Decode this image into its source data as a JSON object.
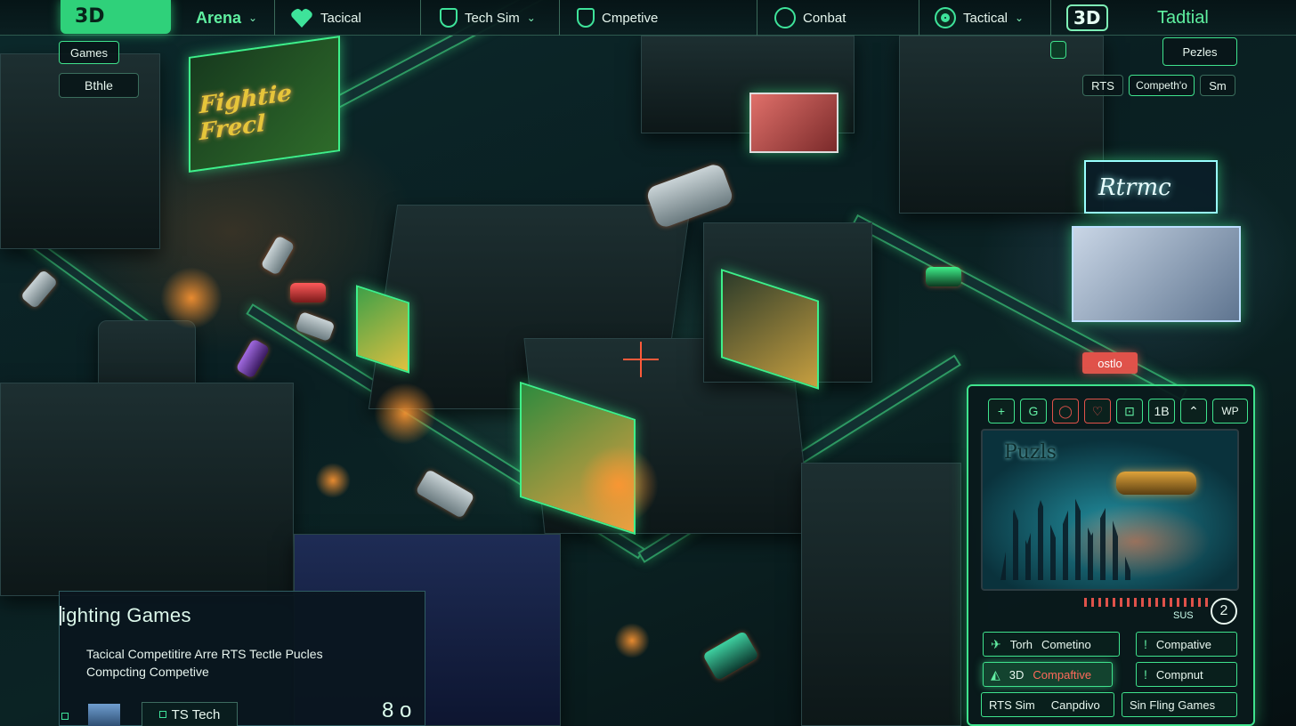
{
  "topbar": {
    "logo": "3D",
    "arena": "Arena",
    "items": [
      "Tacical",
      "Tech Sim",
      "Cmpetive",
      "Conbat",
      "Tactical"
    ],
    "badge": "3D",
    "right_label": "Tadtial"
  },
  "top_left": {
    "games": "Games",
    "battle": "Bthle"
  },
  "top_right": {
    "puzzles": "Pezles",
    "tabs": [
      "RTS",
      "Competh'o",
      "Sm"
    ]
  },
  "billboards": {
    "left_sign": "Fightie Frecl",
    "right_sign": "Rtrmc"
  },
  "floating_tag": "ostlo",
  "info_card": {
    "title": "ighting Games",
    "desc_line1": "Tacical Competitire Arre RTS Tectle Pucles",
    "desc_line2": "Compcting Competive",
    "tag": "TS Tech",
    "glyph": "8 o"
  },
  "right_panel": {
    "tools": [
      "+",
      "G",
      "◯",
      "♡",
      "⊡",
      "1B",
      "⌃",
      "WP"
    ],
    "preview_title": "Puzls",
    "meta": "SUS",
    "count": "2",
    "buttons": [
      {
        "icon": "✈",
        "a": "Torh",
        "b": "Cometino"
      },
      {
        "icon": "!",
        "a": "Compative",
        "b": ""
      },
      {
        "icon": "◭",
        "a": "3D",
        "b": "Compaftive"
      },
      {
        "icon": "!",
        "a": "Compnut",
        "b": ""
      },
      {
        "icon": "",
        "a": "RTS Sim",
        "b": "Canpdivo"
      },
      {
        "icon": "",
        "a": "Sin Fling Games",
        "b": ""
      }
    ]
  },
  "colors": {
    "accent": "#3fe38d",
    "alert": "#e0524a",
    "panel": "#0a1a1c"
  }
}
